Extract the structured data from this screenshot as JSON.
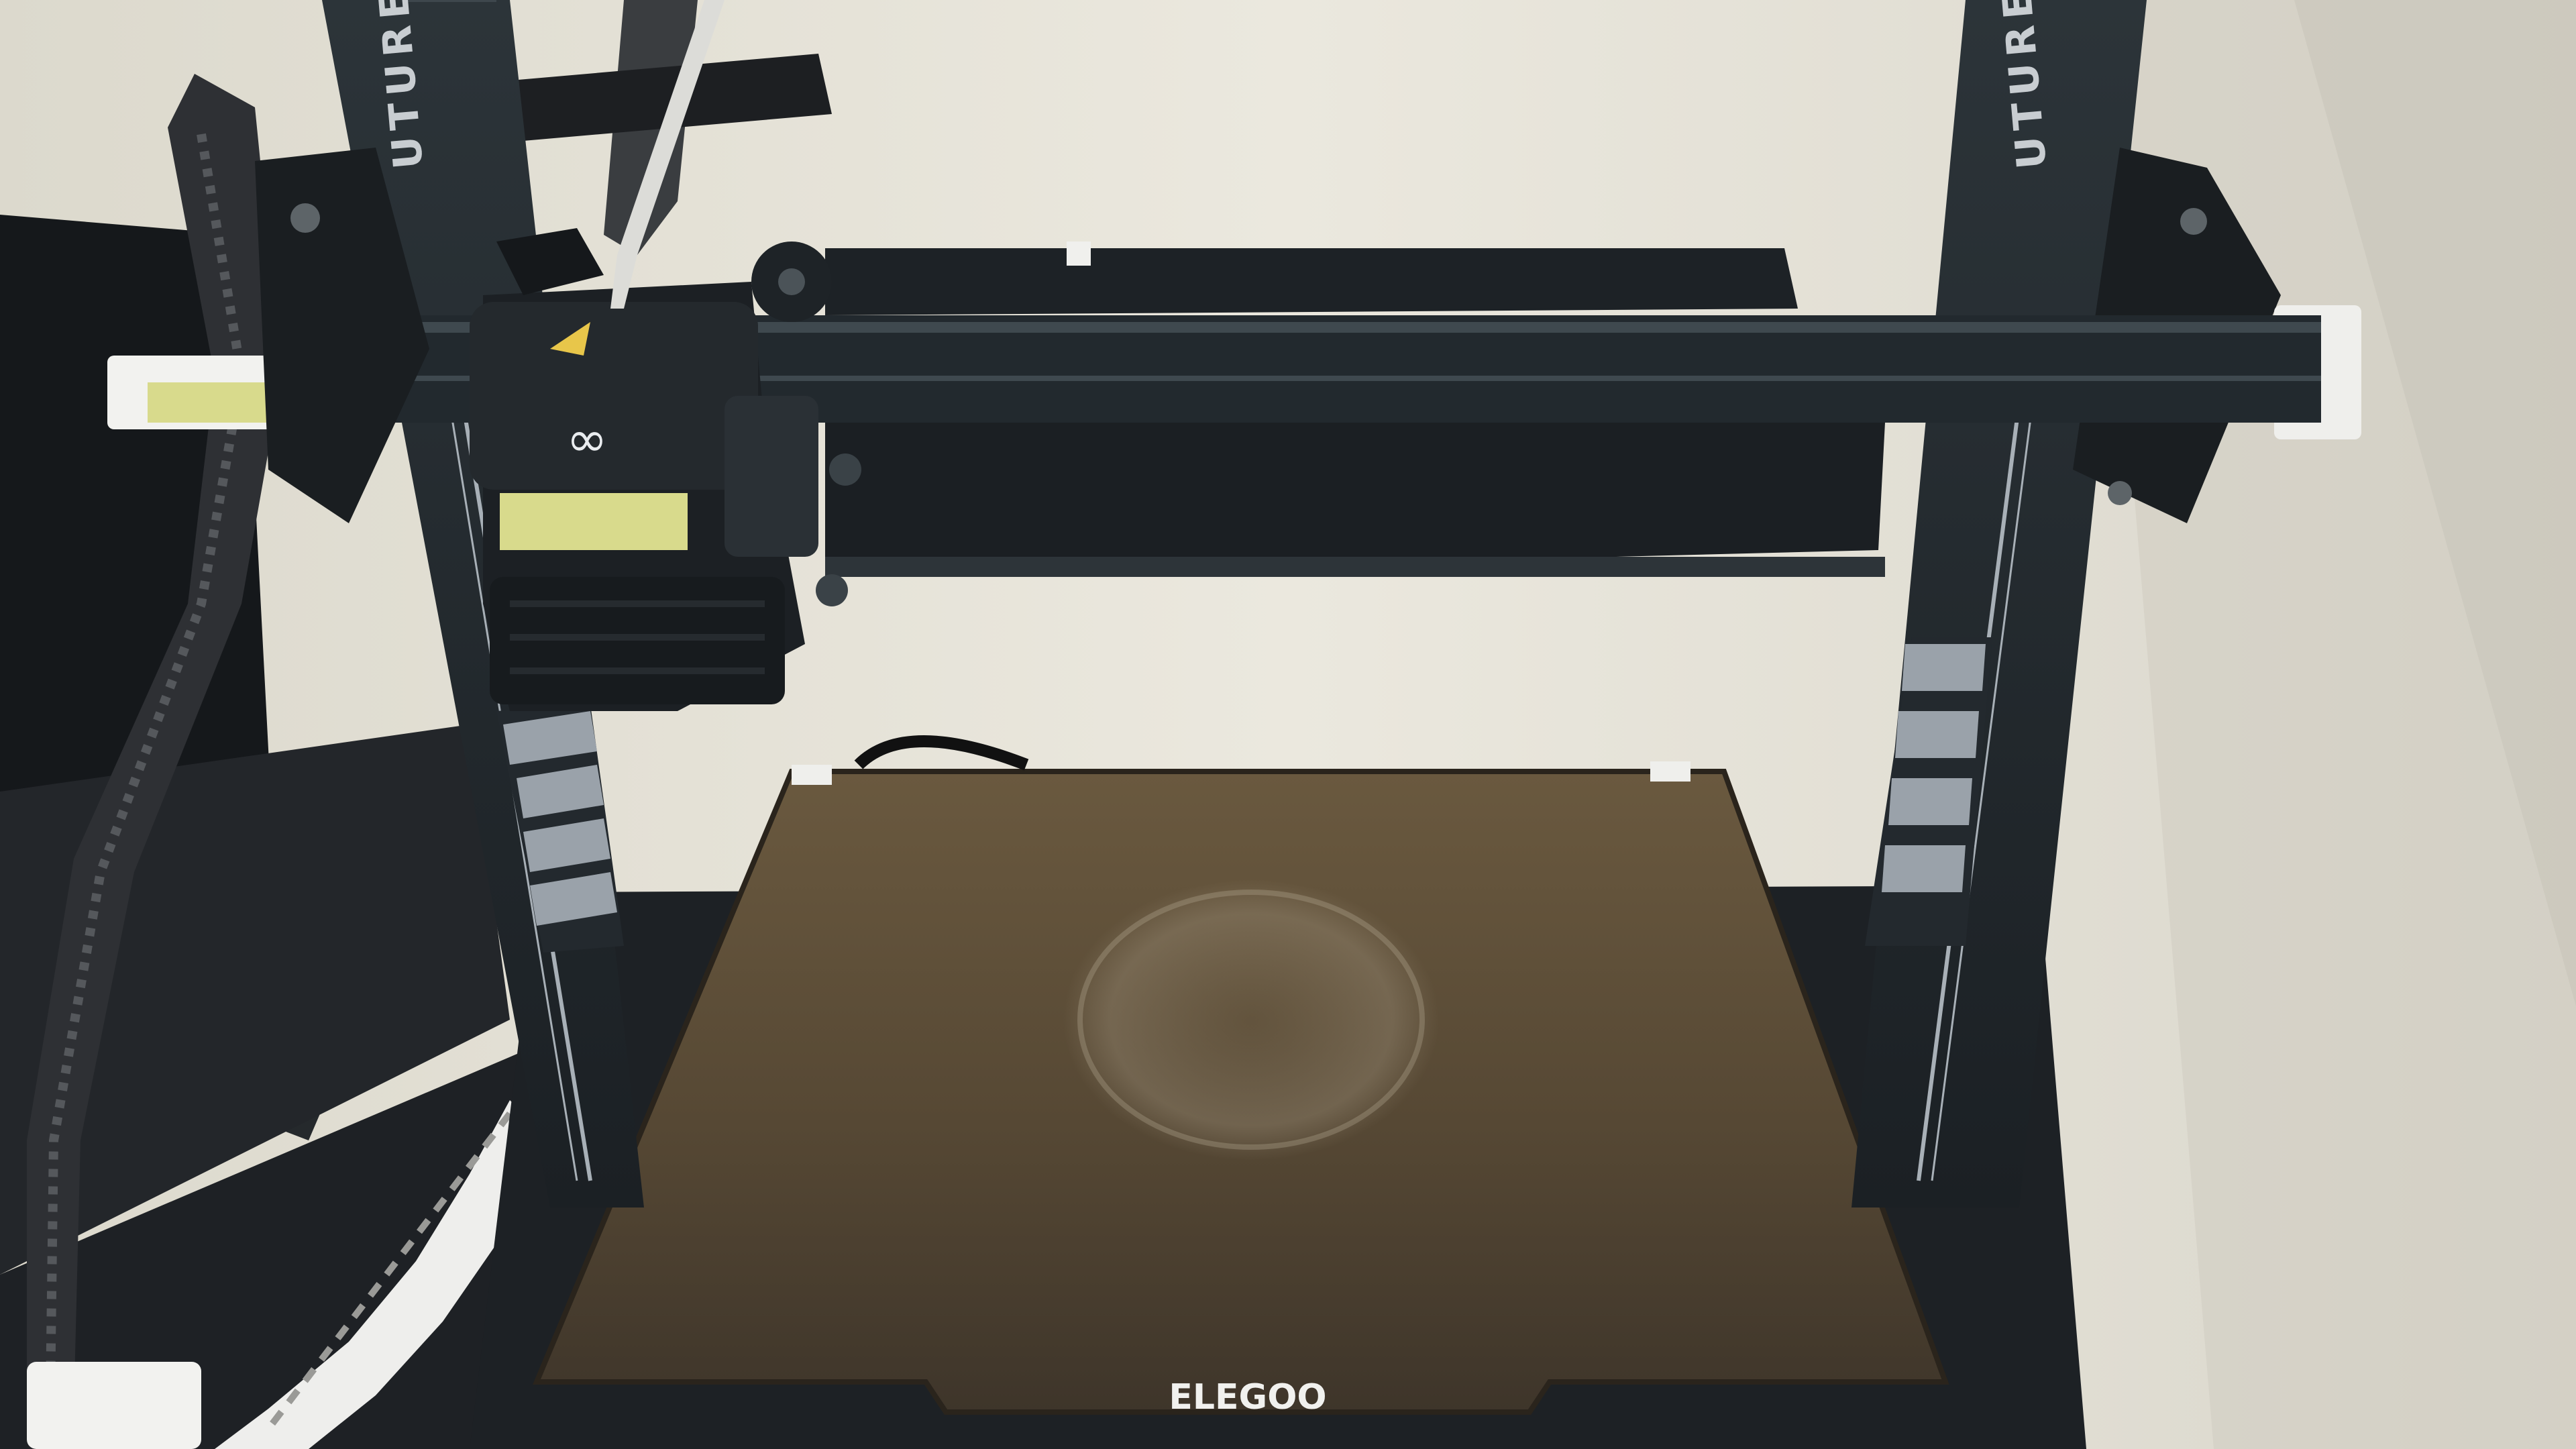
{
  "scene": {
    "subject": "3d-printer",
    "brand_plate_text": "ELEGOO",
    "frame_side_text": "UTURE",
    "colors": {
      "wall": "#e6e3d9",
      "frame": "#23292e",
      "bed": "#5b4c36",
      "label_tape": "#d8da8c",
      "stripe": "#9aa2aa"
    }
  }
}
